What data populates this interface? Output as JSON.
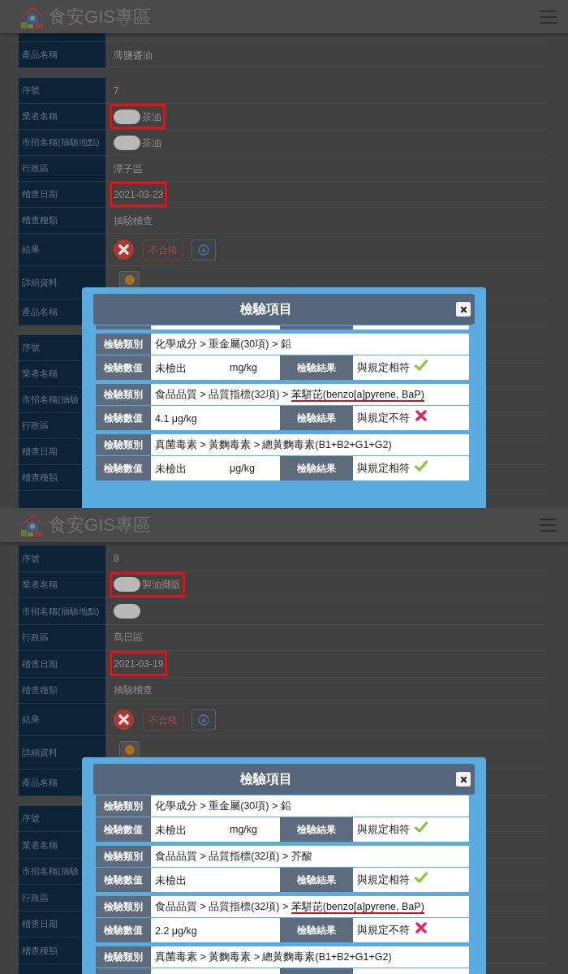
{
  "screens": [
    {
      "header": {
        "title": "食安GIS專區"
      },
      "records": [
        {
          "cut_top": true,
          "cut_bottom": false,
          "fields": [
            {
              "label": "產品名稱",
              "kind": "text",
              "value": "薄鹽醬油",
              "highlighted": false
            }
          ]
        },
        {
          "cut_top": false,
          "cut_bottom": false,
          "fields": [
            {
              "label": "序號",
              "kind": "text",
              "value": "7",
              "highlighted": false
            },
            {
              "label": "業者名稱",
              "kind": "name",
              "redacted": true,
              "value": "茶油",
              "highlighted": true
            },
            {
              "label": "市招名稱(抽驗地點)",
              "kind": "name",
              "redacted": true,
              "value": "茶油",
              "highlighted": false
            },
            {
              "label": "行政區",
              "kind": "text",
              "value": "潭子區",
              "highlighted": false
            },
            {
              "label": "稽查日期",
              "kind": "text",
              "value": "2021-03-23",
              "highlighted": true
            },
            {
              "label": "稽查種類",
              "kind": "text",
              "value": "抽驗稽查",
              "highlighted": false
            },
            {
              "label": "結果",
              "kind": "result",
              "passed": false,
              "badge": "不合格",
              "highlighted": false
            },
            {
              "label": "詳細資料",
              "kind": "detail",
              "highlighted": false
            },
            {
              "label": "產品名稱",
              "kind": "covered",
              "highlighted": false
            }
          ]
        },
        {
          "cut_top": false,
          "cut_bottom": true,
          "fields": [
            {
              "label": "序號",
              "kind": "covered",
              "highlighted": false
            },
            {
              "label": "業者名稱",
              "kind": "covered",
              "highlighted": false
            },
            {
              "label": "市招名稱(抽驗",
              "kind": "covered",
              "highlighted": false
            },
            {
              "label": "行政區",
              "kind": "covered",
              "highlighted": false
            },
            {
              "label": "稽查日期",
              "kind": "covered",
              "highlighted": false
            },
            {
              "label": "稽查種類",
              "kind": "covered",
              "highlighted": false
            }
          ]
        }
      ],
      "modal": {
        "title": "檢驗項目",
        "cut_top": true,
        "cut_bottom": false,
        "tests": [
          {
            "category_label": "檢驗類別",
            "category": [
              {
                "text": "化學成分 > 重金屬(30項) > 鉛",
                "underlined": false
              }
            ],
            "value_label": "檢驗數值",
            "value": "未檢出",
            "unit": "mg/kg",
            "result_label": "檢驗結果",
            "result": "與規定相符",
            "compliant": true
          },
          {
            "category_label": "檢驗類別",
            "category": [
              {
                "text": "食品品質 > 品質指標(32項) > ",
                "underlined": false
              },
              {
                "text": "苯駢芘(benzo[a]pyrene, BaP)",
                "underlined": true
              }
            ],
            "value_label": "檢驗數值",
            "value": "4.1 μg/kg",
            "result_label": "檢驗結果",
            "result": "與規定不符",
            "compliant": false
          },
          {
            "category_label": "檢驗類別",
            "category": [
              {
                "text": "真菌毒素 > 黃麴毒素 > 總黃麴毒素(B1+B2+G1+G2)",
                "underlined": false
              }
            ],
            "value_label": "檢驗數值",
            "value": "未檢出",
            "unit": "μg/kg",
            "result_label": "檢驗結果",
            "result": "與規定相符",
            "compliant": true
          }
        ]
      }
    },
    {
      "header": {
        "title": "食安GIS專區"
      },
      "records": [
        {
          "cut_top": false,
          "cut_bottom": false,
          "fields": [
            {
              "label": "序號",
              "kind": "text",
              "value": "8",
              "highlighted": false
            },
            {
              "label": "業者名稱",
              "kind": "name",
              "redacted": true,
              "value": "製油攤販",
              "highlighted": true
            },
            {
              "label": "市招名稱(抽驗地點)",
              "kind": "name",
              "redacted": true,
              "highlighted": false
            },
            {
              "label": "行政區",
              "kind": "text",
              "value": "烏日區",
              "highlighted": false
            },
            {
              "label": "稽查日期",
              "kind": "text",
              "value": "2021-03-19",
              "highlighted": true
            },
            {
              "label": "稽查種類",
              "kind": "text",
              "value": "抽驗稽查",
              "highlighted": false
            },
            {
              "label": "結果",
              "kind": "result",
              "passed": false,
              "badge": "不合格",
              "highlighted": false
            },
            {
              "label": "詳細資料",
              "kind": "detail",
              "highlighted": false
            },
            {
              "label": "產品名稱",
              "kind": "covered",
              "highlighted": false
            }
          ]
        },
        {
          "cut_top": false,
          "cut_bottom": true,
          "fields": [
            {
              "label": "序號",
              "kind": "covered",
              "highlighted": false
            },
            {
              "label": "業者名稱",
              "kind": "covered",
              "highlighted": false
            },
            {
              "label": "市招名稱(抽驗",
              "kind": "covered",
              "highlighted": false
            },
            {
              "label": "行政區",
              "kind": "covered",
              "highlighted": false
            },
            {
              "label": "稽查日期",
              "kind": "covered",
              "highlighted": false
            },
            {
              "label": "稽查種類",
              "kind": "covered",
              "highlighted": false
            }
          ]
        }
      ],
      "modal": {
        "title": "檢驗項目",
        "cut_top": false,
        "cut_bottom": true,
        "tests": [
          {
            "category_label": "檢驗類別",
            "category": [
              {
                "text": "化學成分 > 重金屬(30項) > 鉛",
                "underlined": false
              }
            ],
            "value_label": "檢驗數值",
            "value": "未檢出",
            "unit": "mg/kg",
            "result_label": "檢驗結果",
            "result": "與規定相符",
            "compliant": true
          },
          {
            "category_label": "檢驗類別",
            "category": [
              {
                "text": "食品品質 > 品質指標(32項) > 芥酸",
                "underlined": false
              }
            ],
            "value_label": "檢驗數值",
            "value": "未檢出",
            "result_label": "檢驗結果",
            "result": "與規定相符",
            "compliant": true
          },
          {
            "category_label": "檢驗類別",
            "category": [
              {
                "text": "食品品質 > 品質指標(32項) > ",
                "underlined": false
              },
              {
                "text": "苯駢芘(benzo[a]pyrene, BaP)",
                "underlined": true
              }
            ],
            "value_label": "檢驗數值",
            "value": "2.2 μg/kg",
            "result_label": "檢驗結果",
            "result": "與規定不符",
            "compliant": false
          },
          {
            "category_label": "檢驗類別",
            "category": [
              {
                "text": "真菌毒素 > 黃麴毒素 > 總黃麴毒素(B1+B2+G1+G2)",
                "underlined": false
              }
            ]
          }
        ]
      }
    }
  ]
}
